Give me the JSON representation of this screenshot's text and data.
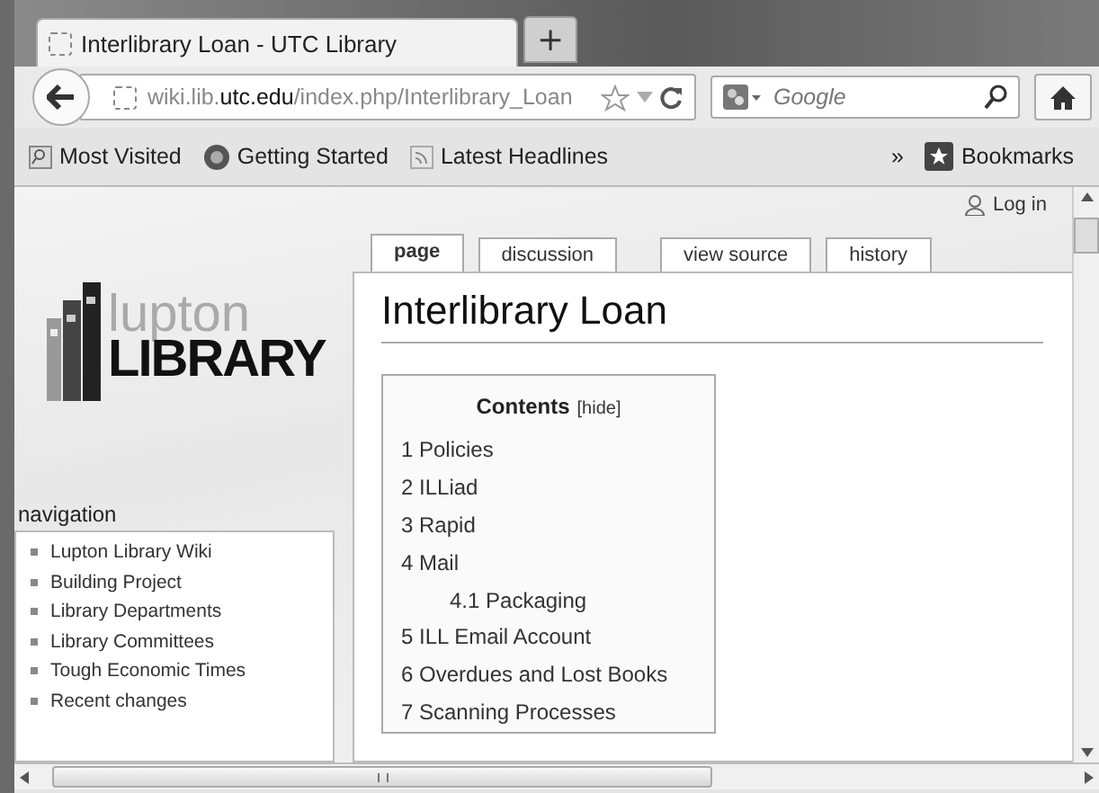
{
  "browser_tab": {
    "title": "Interlibrary Loan - UTC Library",
    "new_tab": "+"
  },
  "address_bar": {
    "url": "wiki.lib.**utc.edu**/index.php/Interlibrary_Loan"
  },
  "search": {
    "placeholder": "Google"
  },
  "bookmarks": [
    "Most Visited",
    "Getting Started",
    "Latest Headlines"
  ],
  "bookmarks_overflow": "»",
  "bookmarks_menu": "Bookmarks",
  "login": "Log in",
  "logo": {
    "top": "lupton",
    "bottom": "LIBRARY"
  },
  "navigation": {
    "title": "navigation",
    "items": [
      "Lupton Library Wiki",
      "Building Project",
      "Library Departments",
      "Library Committees",
      "Tough Economic Times",
      "Recent changes"
    ]
  },
  "page_tabs": [
    {
      "label": "page",
      "selected": true
    },
    {
      "label": "discussion",
      "selected": false
    },
    {
      "label": "view source",
      "selected": false
    },
    {
      "label": "history",
      "selected": false
    }
  ],
  "heading": "Interlibrary Loan",
  "toc": {
    "title": "Contents",
    "toggle": "[hide]",
    "items": [
      {
        "label": "1 Policies"
      },
      {
        "label": "2 ILLiad"
      },
      {
        "label": "3 Rapid"
      },
      {
        "label": "4 Mail",
        "children": [
          {
            "label": "4.1 Packaging"
          }
        ]
      },
      {
        "label": "5 ILL Email Account"
      },
      {
        "label": "6 Overdues and Lost Books"
      },
      {
        "label": "7 Scanning Processes"
      }
    ]
  }
}
